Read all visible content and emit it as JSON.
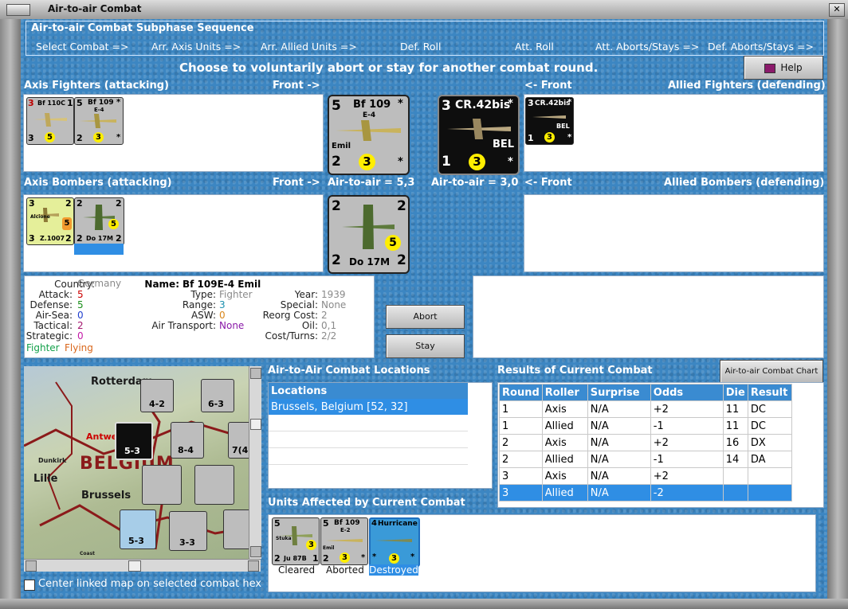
{
  "window": {
    "title": "Air-to-air Combat"
  },
  "subphase": {
    "title": "Air-to-air Combat Subphase Sequence",
    "steps": [
      "Select Combat =>",
      "Arr. Axis Units =>",
      "Arr. Allied Units =>",
      "Def. Roll",
      "Att. Roll",
      "Att. Aborts/Stays =>",
      "Def. Aborts/Stays =>"
    ]
  },
  "instruction": "Choose to voluntarily abort or stay for another combat round.",
  "help_button": "Help",
  "headers": {
    "axis_fighters": "Axis Fighters (attacking)",
    "front_right": "Front ->",
    "front_left": "<- Front",
    "allied_fighters": "Allied Fighters (defending)",
    "axis_bombers": "Axis Bombers (attacking)",
    "allied_bombers": "Allied Bombers (defending)"
  },
  "air_to_air": {
    "axis": "Air-to-air = 5,3",
    "allied": "Air-to-air = 3,0"
  },
  "units": {
    "bf110": {
      "left": "3",
      "name": "Bf 110C",
      "right": "1",
      "bl": "3",
      "circle": "5",
      "br": ""
    },
    "bf109_small": {
      "tl": "5",
      "name": "Bf 109",
      "sub": "E-4",
      "star": "*",
      "bl": "2",
      "circle": "3",
      "br": "*"
    },
    "bf109_big": {
      "tl": "5",
      "name": "Bf 109",
      "sub": "E-4",
      "star": "*",
      "nick": "Emil",
      "bl": "2",
      "circle": "3",
      "br": "*"
    },
    "cr42_big": {
      "tl": "3",
      "name": "CR.42bis",
      "star": "*",
      "nation": "BEL",
      "bl": "1",
      "circle": "3",
      "br": "*"
    },
    "cr42_small": {
      "tl": "3",
      "name": "CR.42bis",
      "star": "*",
      "nation": "BEL",
      "bl": "1",
      "circle": "3",
      "br": "*"
    },
    "z1007": {
      "tl": "3",
      "tr": "2",
      "nick": "Alcione",
      "circle": "5",
      "name": "Z.1007",
      "bl": "3",
      "br": "2"
    },
    "do17_small": {
      "tl": "2",
      "tr": "2",
      "circle": "5",
      "name": "Do 17M",
      "bl": "2",
      "br": "2"
    },
    "do17_big": {
      "tl": "2",
      "tr": "2",
      "circle": "5",
      "name": "Do 17M",
      "bl": "2",
      "br": "2"
    }
  },
  "info": {
    "labels": [
      "Country:",
      "Attack:",
      "Defense:",
      "Air-Sea:",
      "Tactical:",
      "Strategic:"
    ],
    "values": [
      "Germany",
      "5",
      "5",
      "0",
      "2",
      "0"
    ],
    "class1": "Fighter",
    "class2": "Flying",
    "name_label": "Name:",
    "name_value": "Bf 109E-4 Emil",
    "mid_labels": [
      "Type:",
      "Range:",
      "ASW:",
      "Air Transport:"
    ],
    "mid_values": [
      "Fighter",
      "3",
      "0",
      "None"
    ],
    "right_labels": [
      "Year:",
      "Special:",
      "Reorg Cost:",
      "Oil:",
      "Cost/Turns:"
    ],
    "right_values": [
      "1939",
      "None",
      "2",
      "0,1",
      "2/2"
    ]
  },
  "buttons": {
    "abort": "Abort",
    "stay": "Stay",
    "chart": "Air-to-air Combat Chart"
  },
  "locations": {
    "title": "Air-to-Air Combat Locations",
    "header": "Locations",
    "rows": [
      "Brussels, Belgium [52, 32]"
    ]
  },
  "results": {
    "title": "Results of Current Combat",
    "columns": [
      "Round",
      "Roller",
      "Surprise",
      "Odds",
      "Die",
      "Result"
    ],
    "rows": [
      [
        "1",
        "Axis",
        "N/A",
        "+2",
        "11",
        "DC"
      ],
      [
        "1",
        "Allied",
        "N/A",
        "-1",
        "11",
        "DC"
      ],
      [
        "2",
        "Axis",
        "N/A",
        "+2",
        "16",
        "DX"
      ],
      [
        "2",
        "Allied",
        "N/A",
        "-1",
        "14",
        "DA"
      ],
      [
        "3",
        "Axis",
        "N/A",
        "+2",
        "",
        ""
      ],
      [
        "3",
        "Allied",
        "N/A",
        "-2",
        "",
        ""
      ]
    ]
  },
  "affected": {
    "title": "Units Affected by Current Combat",
    "units": [
      {
        "tl": "5",
        "nick": "Stuka",
        "circle": "3",
        "bl": "2",
        "name": "Ju 87B",
        "br": "1",
        "status": "Cleared"
      },
      {
        "tl": "5",
        "name": "Bf 109",
        "sub": "E-2",
        "nick": "Emil",
        "circle": "3",
        "bl": "2",
        "br": "*",
        "status": "Aborted"
      },
      {
        "tl": "4",
        "name": "Hurricane",
        "circle": "3",
        "bl": "*",
        "br": "*",
        "status": "Destroyed"
      }
    ]
  },
  "map": {
    "cities": [
      "Rotterdam",
      "Antwerp",
      "Lille",
      "Brussels",
      "Dunkirk",
      "Coast"
    ],
    "country": "BELGIUM",
    "counters": [
      "4-2",
      "6-3",
      "5-3",
      "8-4",
      "7(4)",
      "5-3",
      "3-3"
    ]
  },
  "center_checkbox": "Center linked map on selected combat hex",
  "colors": {
    "panel": "#3c86c2",
    "selection": "#2f8ee4",
    "attack": "#cc0000",
    "defense": "#1a8f1a",
    "grey_value": "#8a8a8a"
  }
}
